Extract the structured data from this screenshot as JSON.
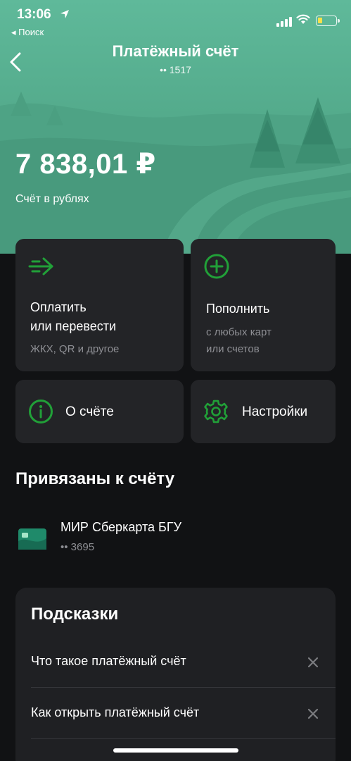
{
  "status_bar": {
    "time": "13:06",
    "back_app": "◂ Поиск"
  },
  "header": {
    "title": "Платёжный счёт",
    "account_mask": "•• 1517"
  },
  "account": {
    "balance": "7 838,01 ₽",
    "caption": "Счёт в рублях"
  },
  "actions": {
    "pay": {
      "title_line1": "Оплатить",
      "title_line2": "или перевести",
      "subtitle": "ЖКХ, QR и другое",
      "icon": "arrow-right-icon"
    },
    "topup": {
      "title": "Пополнить",
      "subtitle_line1": "с любых карт",
      "subtitle_line2": "или счетов",
      "icon": "plus-circle-icon"
    },
    "about": {
      "label": "О счёте",
      "icon": "info-icon"
    },
    "settings": {
      "label": "Настройки",
      "icon": "gear-icon"
    }
  },
  "linked": {
    "heading": "Привязаны к счёту",
    "cards": [
      {
        "name": "МИР Сберкарта БГУ",
        "mask": "•• 3695"
      }
    ]
  },
  "tips": {
    "heading": "Подсказки",
    "items": [
      {
        "text": "Что такое платёжный счёт"
      },
      {
        "text": "Как открыть платёжный счёт"
      }
    ]
  },
  "colors": {
    "accent": "#21a038",
    "background": "#111214",
    "card": "#232427",
    "hero": "#54ab8c"
  }
}
